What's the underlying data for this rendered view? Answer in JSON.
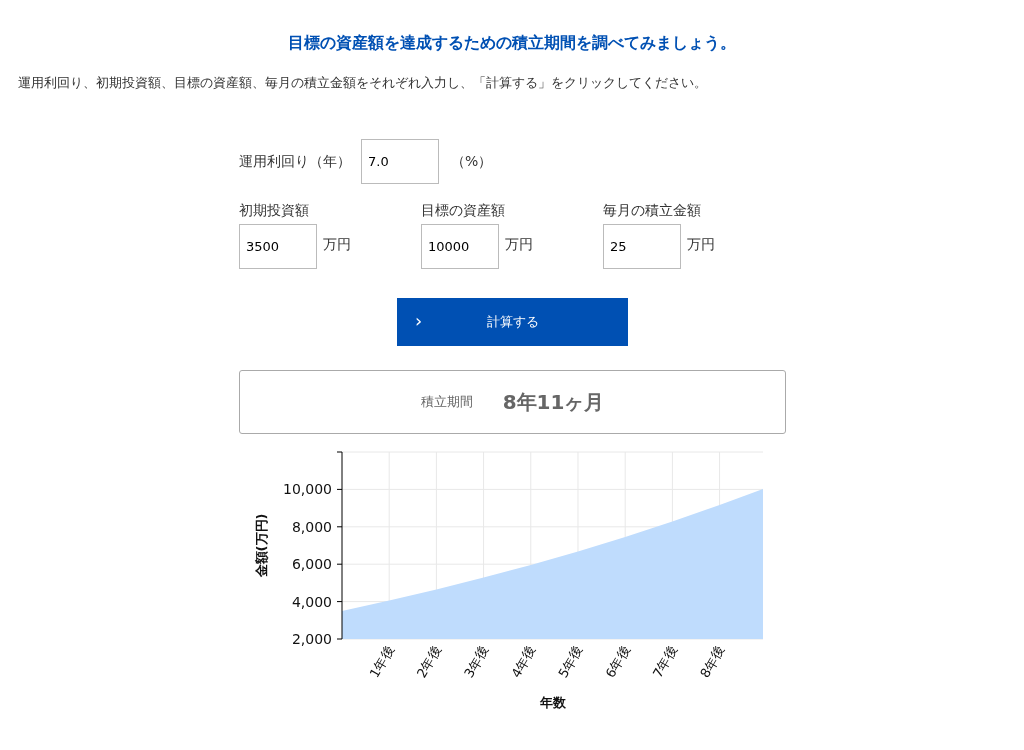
{
  "heading": "目標の資産額を達成するための積立期間を調べてみましょう。",
  "instructions": "運用利回り、初期投資額、目標の資産額、毎月の積立金額をそれぞれ入力し、「計算する」をクリックしてください。",
  "rate_field": {
    "label": "運用利回り（年）",
    "value": "7.0",
    "unit": "（%）"
  },
  "fields": [
    {
      "label": "初期投資額",
      "value": "3500",
      "unit": "万円"
    },
    {
      "label": "目標の資産額",
      "value": "10000",
      "unit": "万円"
    },
    {
      "label": "毎月の積立金額",
      "value": "25",
      "unit": "万円"
    }
  ],
  "calculate_button": {
    "icon": "›",
    "label": "計算する"
  },
  "result": {
    "label": "積立期間",
    "value": "8年11ヶ月"
  },
  "chart_data": {
    "type": "area",
    "xlabel": "年数",
    "ylabel": "金額(万円)",
    "x": [
      0,
      1,
      2,
      3,
      4,
      5,
      6,
      7,
      8,
      8.92
    ],
    "grid": true,
    "series": [
      {
        "color": "#bfdcfd",
        "values": [
          3500,
          4060,
          4650,
          5290,
          5960,
          6680,
          7460,
          8280,
          9170,
          10020
        ]
      }
    ],
    "xlim": [
      0,
      8.92
    ],
    "ylim": [
      2000,
      12000
    ],
    "xticks": [
      {
        "value": 1,
        "label": "1年後"
      },
      {
        "value": 2,
        "label": "2年後"
      },
      {
        "value": 3,
        "label": "3年後"
      },
      {
        "value": 4,
        "label": "4年後"
      },
      {
        "value": 5,
        "label": "5年後"
      },
      {
        "value": 6,
        "label": "6年後"
      },
      {
        "value": 7,
        "label": "7年後"
      },
      {
        "value": 8,
        "label": "8年後"
      }
    ],
    "yticks": [
      {
        "value": 2000,
        "label": "2,000"
      },
      {
        "value": 4000,
        "label": "4,000"
      },
      {
        "value": 6000,
        "label": "6,000"
      },
      {
        "value": 8000,
        "label": "8,000"
      },
      {
        "value": 10000,
        "label": "10,000"
      }
    ]
  }
}
